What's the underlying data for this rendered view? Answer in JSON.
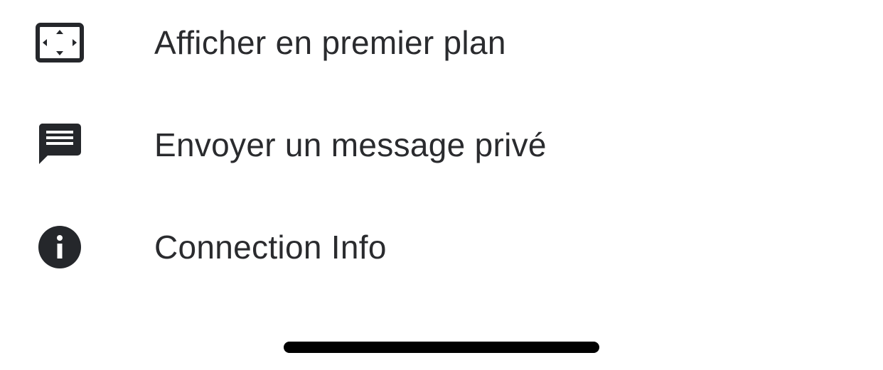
{
  "menu": {
    "items": [
      {
        "label": "Afficher en premier plan",
        "icon": "fullscreen-icon"
      },
      {
        "label": "Envoyer un message privé",
        "icon": "message-icon"
      },
      {
        "label": "Connection Info",
        "icon": "info-icon"
      }
    ]
  },
  "colors": {
    "text": "#2a2b2e",
    "icon": "#25272b",
    "background": "#ffffff",
    "home_indicator": "#000000"
  }
}
